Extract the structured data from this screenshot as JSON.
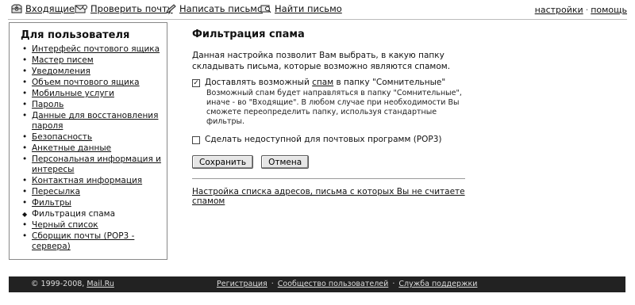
{
  "toolbar": {
    "inbox": "Входящие",
    "check_mail": "Проверить почту",
    "compose": "Написать письмо",
    "search": "Найти письмо",
    "settings": "настройки",
    "separator": "·",
    "help": "помощь"
  },
  "sidebar": {
    "title": "Для пользователя",
    "bullet": "◆",
    "items": [
      {
        "label": "Интерфейс почтового ящика"
      },
      {
        "label": "Мастер писем"
      },
      {
        "label": "Уведомления"
      },
      {
        "label": "Объем почтового ящика"
      },
      {
        "label": "Мобильные услуги"
      },
      {
        "label": "Пароль"
      },
      {
        "label": "Данные для восстановления пароля"
      },
      {
        "label": "Безопасность"
      },
      {
        "label": "Анкетные данные"
      },
      {
        "label": "Персональная информация и интересы"
      },
      {
        "label": "Контактная информация"
      },
      {
        "label": "Пересылка"
      },
      {
        "label": "Фильтры"
      },
      {
        "label": "Фильтрация спама"
      },
      {
        "label": "Черный список"
      },
      {
        "label": "Сборщик почты (POP3 - сервера)"
      }
    ]
  },
  "main": {
    "title": "Фильтрация спама",
    "intro": "Данная настройка позволит Вам выбрать, в какую папку складывать письма, которые возможно являются спамом.",
    "option1": {
      "checked": true,
      "check_mark": "✓",
      "text_before": "Доставлять возможный ",
      "link": "спам",
      "text_after": " в папку \"Сомнительные\"",
      "note": "Возможный спам будет направляться в папку \"Сомнительные\", иначе - во \"Входящие\". В любом случае при необходимости Вы сможете переопределить папку, используя стандартные фильтры."
    },
    "option2": {
      "checked": false,
      "label": "Сделать недоступной для почтовых программ (POP3)"
    },
    "save_label": "Сохранить",
    "cancel_label": "Отмена",
    "whitelist_link": "Настройка списка адресов, письма с которых Вы не считаете спамом"
  },
  "footer": {
    "copyright": "© 1999-2008, ",
    "brand": "Mail.Ru",
    "register": "Регистрация",
    "community": "Сообщество пользователей",
    "support": "Служба поддержки",
    "separator": " · "
  }
}
